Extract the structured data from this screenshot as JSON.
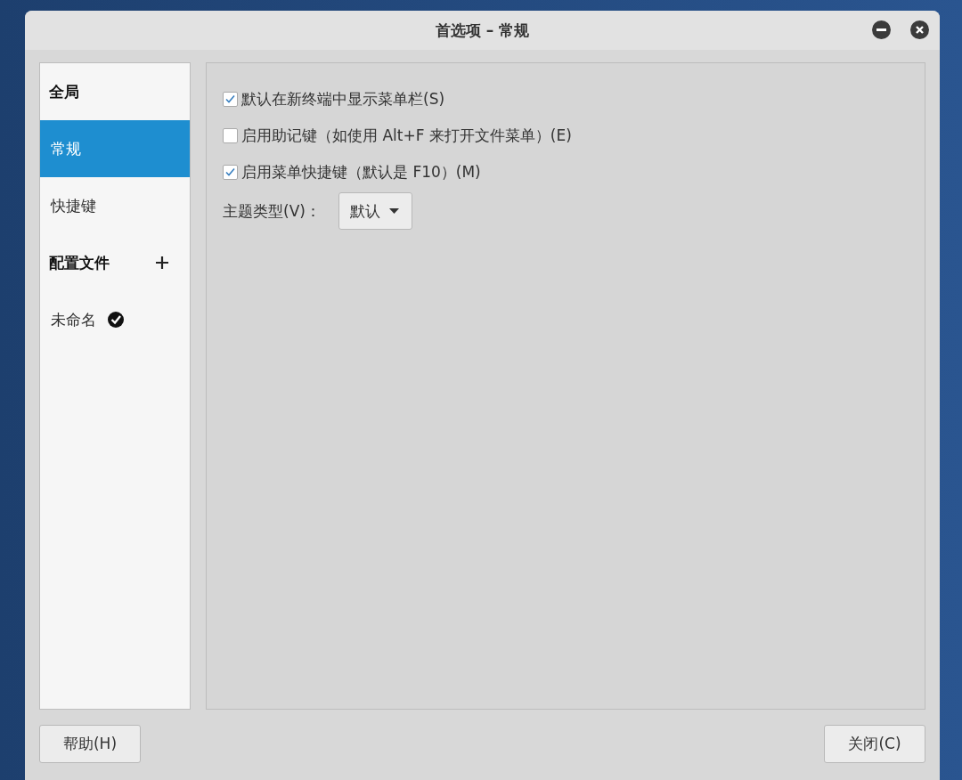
{
  "window": {
    "title": "首选项 – 常规"
  },
  "sidebar": {
    "items": [
      {
        "kind": "heading",
        "label": "全局",
        "selected": false
      },
      {
        "kind": "item",
        "label": "常规",
        "selected": true
      },
      {
        "kind": "item",
        "label": "快捷键",
        "selected": false
      },
      {
        "kind": "heading",
        "label": "配置文件",
        "selected": false,
        "addable": true
      },
      {
        "kind": "item",
        "label": "未命名",
        "selected": false,
        "default": true
      }
    ]
  },
  "options": [
    {
      "label": "默认在新终端中显示菜单栏(S)",
      "checked": true
    },
    {
      "label": "启用助记键（如使用 Alt+F 来打开文件菜单）(E)",
      "checked": false
    },
    {
      "label": "启用菜单快捷键（默认是 F10）(M)",
      "checked": true
    }
  ],
  "theme": {
    "label": "主题类型(V)：",
    "value": "默认"
  },
  "buttons": [
    {
      "label": "帮助(H)"
    },
    {
      "label": "关闭(C)"
    }
  ]
}
